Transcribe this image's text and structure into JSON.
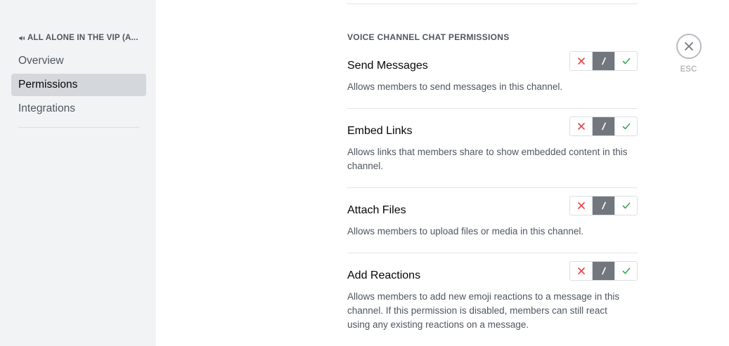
{
  "sidebar": {
    "channel_name": "ALL ALONE IN THE VIP (A...",
    "items": [
      {
        "label": "Overview"
      },
      {
        "label": "Permissions"
      },
      {
        "label": "Integrations"
      }
    ]
  },
  "section": {
    "title": "VOICE CHANNEL CHAT PERMISSIONS"
  },
  "permissions": [
    {
      "name": "Send Messages",
      "description": "Allows members to send messages in this channel.",
      "state": "neutral"
    },
    {
      "name": "Embed Links",
      "description": "Allows links that members share to show embedded content in this channel.",
      "state": "neutral"
    },
    {
      "name": "Attach Files",
      "description": "Allows members to upload files or media in this channel.",
      "state": "neutral"
    },
    {
      "name": "Add Reactions",
      "description": "Allows members to add new emoji reactions to a message in this channel. If this permission is disabled, members can still react using any existing reactions on a message.",
      "state": "neutral"
    }
  ],
  "toggle": {
    "neutral_label": "/"
  },
  "colors": {
    "deny": "#ed4245",
    "allow": "#3ba55c",
    "neutral_active": "#72767d"
  },
  "close": {
    "label": "ESC"
  }
}
